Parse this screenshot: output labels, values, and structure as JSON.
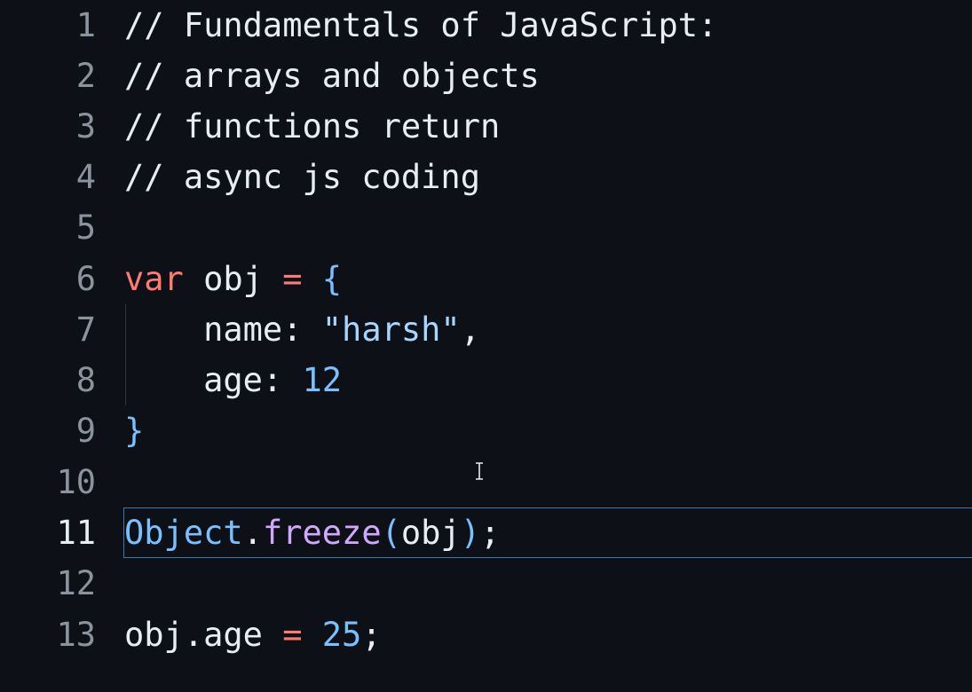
{
  "colors": {
    "background": "#0d1117",
    "line_number": "#8b949e",
    "line_number_active": "#e6edf3",
    "comment": "#e6edf3",
    "keyword": "#ff7b72",
    "identifier": "#e6edf3",
    "operator": "#ff7b72",
    "brace": "#79c0ff",
    "string": "#a5d6ff",
    "number": "#79c0ff",
    "builtin": "#79c0ff",
    "function": "#d2a8ff",
    "active_line_border": "#3d78b0"
  },
  "editor": {
    "active_line": 11,
    "lines": [
      {
        "number": "1",
        "tokens": [
          {
            "t": "// Fundamentals of JavaScript:",
            "k": "comment"
          }
        ]
      },
      {
        "number": "2",
        "tokens": [
          {
            "t": "// arrays and objects",
            "k": "comment"
          }
        ]
      },
      {
        "number": "3",
        "tokens": [
          {
            "t": "// functions return",
            "k": "comment"
          }
        ]
      },
      {
        "number": "4",
        "tokens": [
          {
            "t": "// async js coding",
            "k": "comment"
          }
        ]
      },
      {
        "number": "5",
        "tokens": []
      },
      {
        "number": "6",
        "tokens": [
          {
            "t": "var",
            "k": "keyword"
          },
          {
            "t": " obj ",
            "k": "identifier"
          },
          {
            "t": "=",
            "k": "operator"
          },
          {
            "t": " ",
            "k": "identifier"
          },
          {
            "t": "{",
            "k": "brace"
          }
        ]
      },
      {
        "number": "7",
        "tokens": [
          {
            "t": "    name: ",
            "k": "identifier"
          },
          {
            "t": "\"harsh\"",
            "k": "string"
          },
          {
            "t": ",",
            "k": "identifier"
          }
        ]
      },
      {
        "number": "8",
        "tokens": [
          {
            "t": "    age: ",
            "k": "identifier"
          },
          {
            "t": "12",
            "k": "number"
          }
        ]
      },
      {
        "number": "9",
        "tokens": [
          {
            "t": "}",
            "k": "brace"
          }
        ]
      },
      {
        "number": "10",
        "tokens": []
      },
      {
        "number": "11",
        "tokens": [
          {
            "t": "Object",
            "k": "builtin"
          },
          {
            "t": ".",
            "k": "identifier"
          },
          {
            "t": "freeze",
            "k": "function"
          },
          {
            "t": "(",
            "k": "brace"
          },
          {
            "t": "obj",
            "k": "identifier"
          },
          {
            "t": ")",
            "k": "brace"
          },
          {
            "t": ";",
            "k": "identifier"
          }
        ]
      },
      {
        "number": "12",
        "tokens": []
      },
      {
        "number": "13",
        "tokens": [
          {
            "t": "obj.age ",
            "k": "identifier"
          },
          {
            "t": "=",
            "k": "operator"
          },
          {
            "t": " ",
            "k": "identifier"
          },
          {
            "t": "25",
            "k": "number"
          },
          {
            "t": ";",
            "k": "identifier"
          }
        ]
      }
    ]
  },
  "cursor": {
    "icon": "text-cursor-icon"
  }
}
